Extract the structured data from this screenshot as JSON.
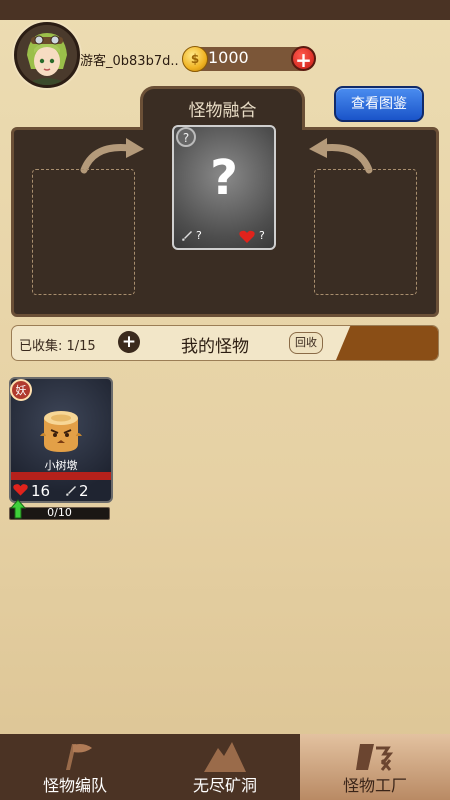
{
  "header": {
    "username": "游客_0b83b7d..",
    "coins": "1000",
    "coin_symbol": "$"
  },
  "fusion": {
    "title": "怪物融合",
    "view_atlas_button": "查看图鉴",
    "mystery_card": {
      "badge": "?",
      "symbol": "?",
      "attack": "?",
      "hp": "?"
    }
  },
  "collection": {
    "collected_label": "已收集: 1/15",
    "add_symbol": "+",
    "title": "我的怪物",
    "recycle_button": "回收"
  },
  "monsters": [
    {
      "type_badge": "妖",
      "name": "小树墩",
      "hp": "16",
      "attack": "2",
      "exp": "0/10"
    }
  ],
  "bottom_nav": [
    {
      "label": "怪物编队",
      "icon": "flag-icon",
      "active": false
    },
    {
      "label": "无尽矿洞",
      "icon": "mountain-icon",
      "active": false
    },
    {
      "label": "怪物工厂",
      "icon": "factory-icon",
      "active": true
    }
  ],
  "colors": {
    "background": "#e6d1a4",
    "panel": "#3a2d23",
    "accent_blue": "#1a54c9",
    "hp_red": "#e0231c",
    "nav": "#4b3324",
    "nav_active": "#d8b692"
  }
}
